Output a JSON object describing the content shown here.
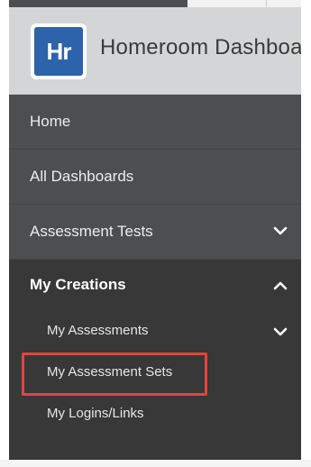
{
  "header": {
    "logo_text": "Hr",
    "title": "Homeroom Dashboard"
  },
  "nav": {
    "home": "Home",
    "all_dashboards": "All Dashboards",
    "assessment_tests": "Assessment Tests",
    "my_creations": {
      "label": "My Creations",
      "expanded": true,
      "items": [
        {
          "label": "My Assessments"
        },
        {
          "label": "My Assessment Sets"
        },
        {
          "label": "My Logins/Links"
        }
      ]
    }
  },
  "icons": {
    "assessment_tests_toggle": "chevron-down-icon",
    "my_creations_toggle": "chevron-up-icon",
    "my_assessments_toggle": "chevron-down-icon"
  },
  "colors": {
    "brand": "#2c63aa",
    "highlight": "#e0463a",
    "nav_bg": "#4d4e4f",
    "section_bg": "#383839"
  }
}
